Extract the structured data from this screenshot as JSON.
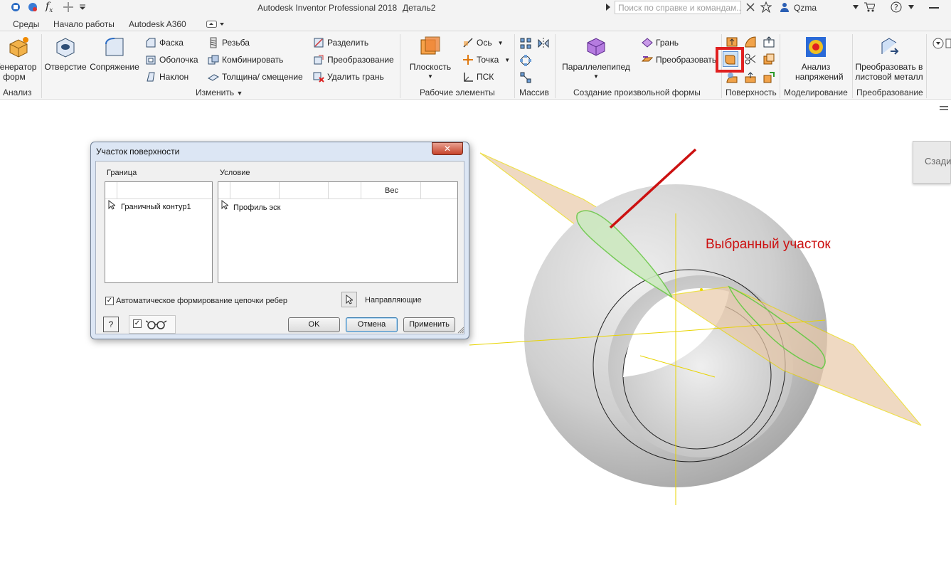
{
  "app": {
    "title": "Autodesk Inventor Professional 2018",
    "document": "Деталь2",
    "search_placeholder": "Поиск по справке и командам...",
    "user": "Qzma"
  },
  "tabs": [
    "Среды",
    "Начало работы",
    "Autodesk A360"
  ],
  "ribbon": {
    "analysis": {
      "button": "Генератор форм",
      "group": "Анализ"
    },
    "modify": {
      "hole": "Отверстие",
      "fillet": "Сопряжение",
      "chamfer": "Фаска",
      "shell": "Оболочка",
      "draft": "Наклон",
      "thread": "Резьба",
      "combine": "Комбинировать",
      "thicken": "Толщина/ смещение",
      "split": "Разделить",
      "direct": "Преобразование",
      "delete_face": "Удалить грань",
      "group": "Изменить"
    },
    "work_features": {
      "plane": "Плоскость",
      "axis": "Ось",
      "point": "Точка",
      "ucs": "ПСК",
      "group": "Рабочие элементы"
    },
    "pattern": {
      "group": "Массив"
    },
    "freeform": {
      "box": "Параллелепипед",
      "face": "Грань",
      "convert": "Преобразовать",
      "group": "Создание произвольной формы"
    },
    "surface": {
      "group": "Поверхность"
    },
    "simulation": {
      "button": "Анализ напряжений",
      "group": "Моделирование"
    },
    "convert": {
      "button": "Преобразовать в листовой металл",
      "group": "Преобразование"
    }
  },
  "viewcube": {
    "label": "Сзади"
  },
  "annotation": {
    "text": "Выбранный участок",
    "color": "#cc1111"
  },
  "dialog": {
    "title": "Участок поверхности",
    "boundary_header": "Граница",
    "condition_header": "Условие",
    "weight_header": "Вес",
    "boundary_row": "Граничный контур1",
    "condition_row": "Профиль эск",
    "auto_chain_label": "Автоматическое формирование цепочки ребер",
    "auto_chain_checked": true,
    "guide_label": "Направляющие",
    "preview_checked": true,
    "ok": "OK",
    "cancel": "Отмена",
    "apply": "Применить"
  },
  "colors": {
    "highlight_box": "#e02020",
    "selection_green": "#6cc94a",
    "sketch_yellow": "#e8d400"
  }
}
